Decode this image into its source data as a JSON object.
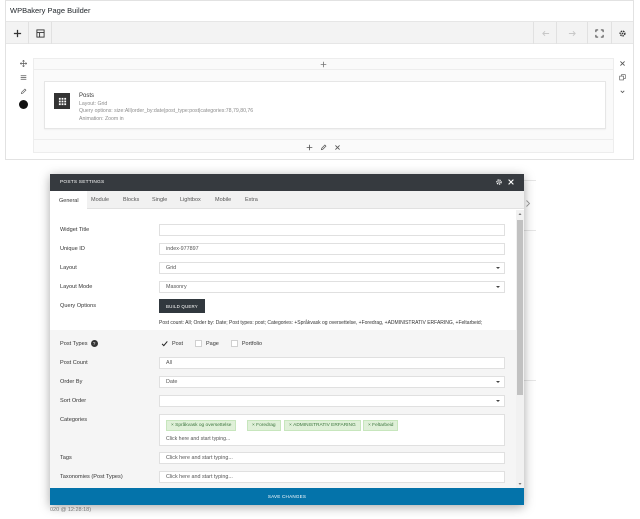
{
  "builder": {
    "title": "WPBakery Page Builder",
    "toolbar": {
      "icons": [
        "plus-icon",
        "layout-template-icon",
        "undo-icon",
        "redo-icon",
        "fullscreen-icon",
        "gear-icon"
      ]
    },
    "element": {
      "name": "Posts",
      "layout": "Layout: Grid",
      "query": "Query options: size:All|order_by:date|post_type:post|categories:78,79,80,76",
      "animation": "Animation: Zoom in"
    }
  },
  "modal": {
    "title": "POSTS SETTINGS",
    "tabs": [
      "General",
      "Module",
      "Blocks",
      "Single",
      "Lightbox",
      "Mobile",
      "Extra"
    ],
    "active_tab": "General",
    "fields": {
      "widget_title_label": "Widget Title",
      "widget_title_value": "",
      "unique_id_label": "Unique ID",
      "unique_id_value": "index-977897",
      "layout_label": "Layout",
      "layout_value": "Grid",
      "layout_mode_label": "Layout Mode",
      "layout_mode_value": "Masonry",
      "query_options_label": "Query Options",
      "build_query_button": "BUILD QUERY",
      "query_summary": "Post count: All; Order by: Date; Post types: post; Categories: +Språkvask og oversettelse, +Foredrag, +ADMINISTRATIV ERFARING, +Feltarbeid;",
      "post_types_label": "Post Types",
      "post_types_help": "?",
      "post_types_options": [
        {
          "label": "Post",
          "checked": true
        },
        {
          "label": "Page",
          "checked": false
        },
        {
          "label": "Portfolio",
          "checked": false
        }
      ],
      "post_count_label": "Post Count",
      "post_count_value": "All",
      "order_by_label": "Order By",
      "order_by_value": "Date",
      "sort_order_label": "Sort Order",
      "sort_order_value": "",
      "categories_label": "Categories",
      "categories_tags": [
        "Språkvask og oversettelse",
        "Foredrag",
        "ADMINISTRATIV ERFARING",
        "Feltarbeid"
      ],
      "categories_placeholder": "Click here and start typing...",
      "tags_label": "Tags",
      "tags_placeholder": "Click here and start typing...",
      "taxonomies_label": "Taxonomies (Post Types)",
      "taxonomies_placeholder": "Click here and start typing..."
    },
    "footer_button": "SAVE CHANGES"
  },
  "background": {
    "timestamp_fragment": "020 @ 12:28:18)"
  },
  "colors": {
    "modal_header": "#363a3f",
    "save_bar": "#0473aa",
    "tag_bg": "#dff0d8",
    "tag_text": "#3c763d"
  }
}
